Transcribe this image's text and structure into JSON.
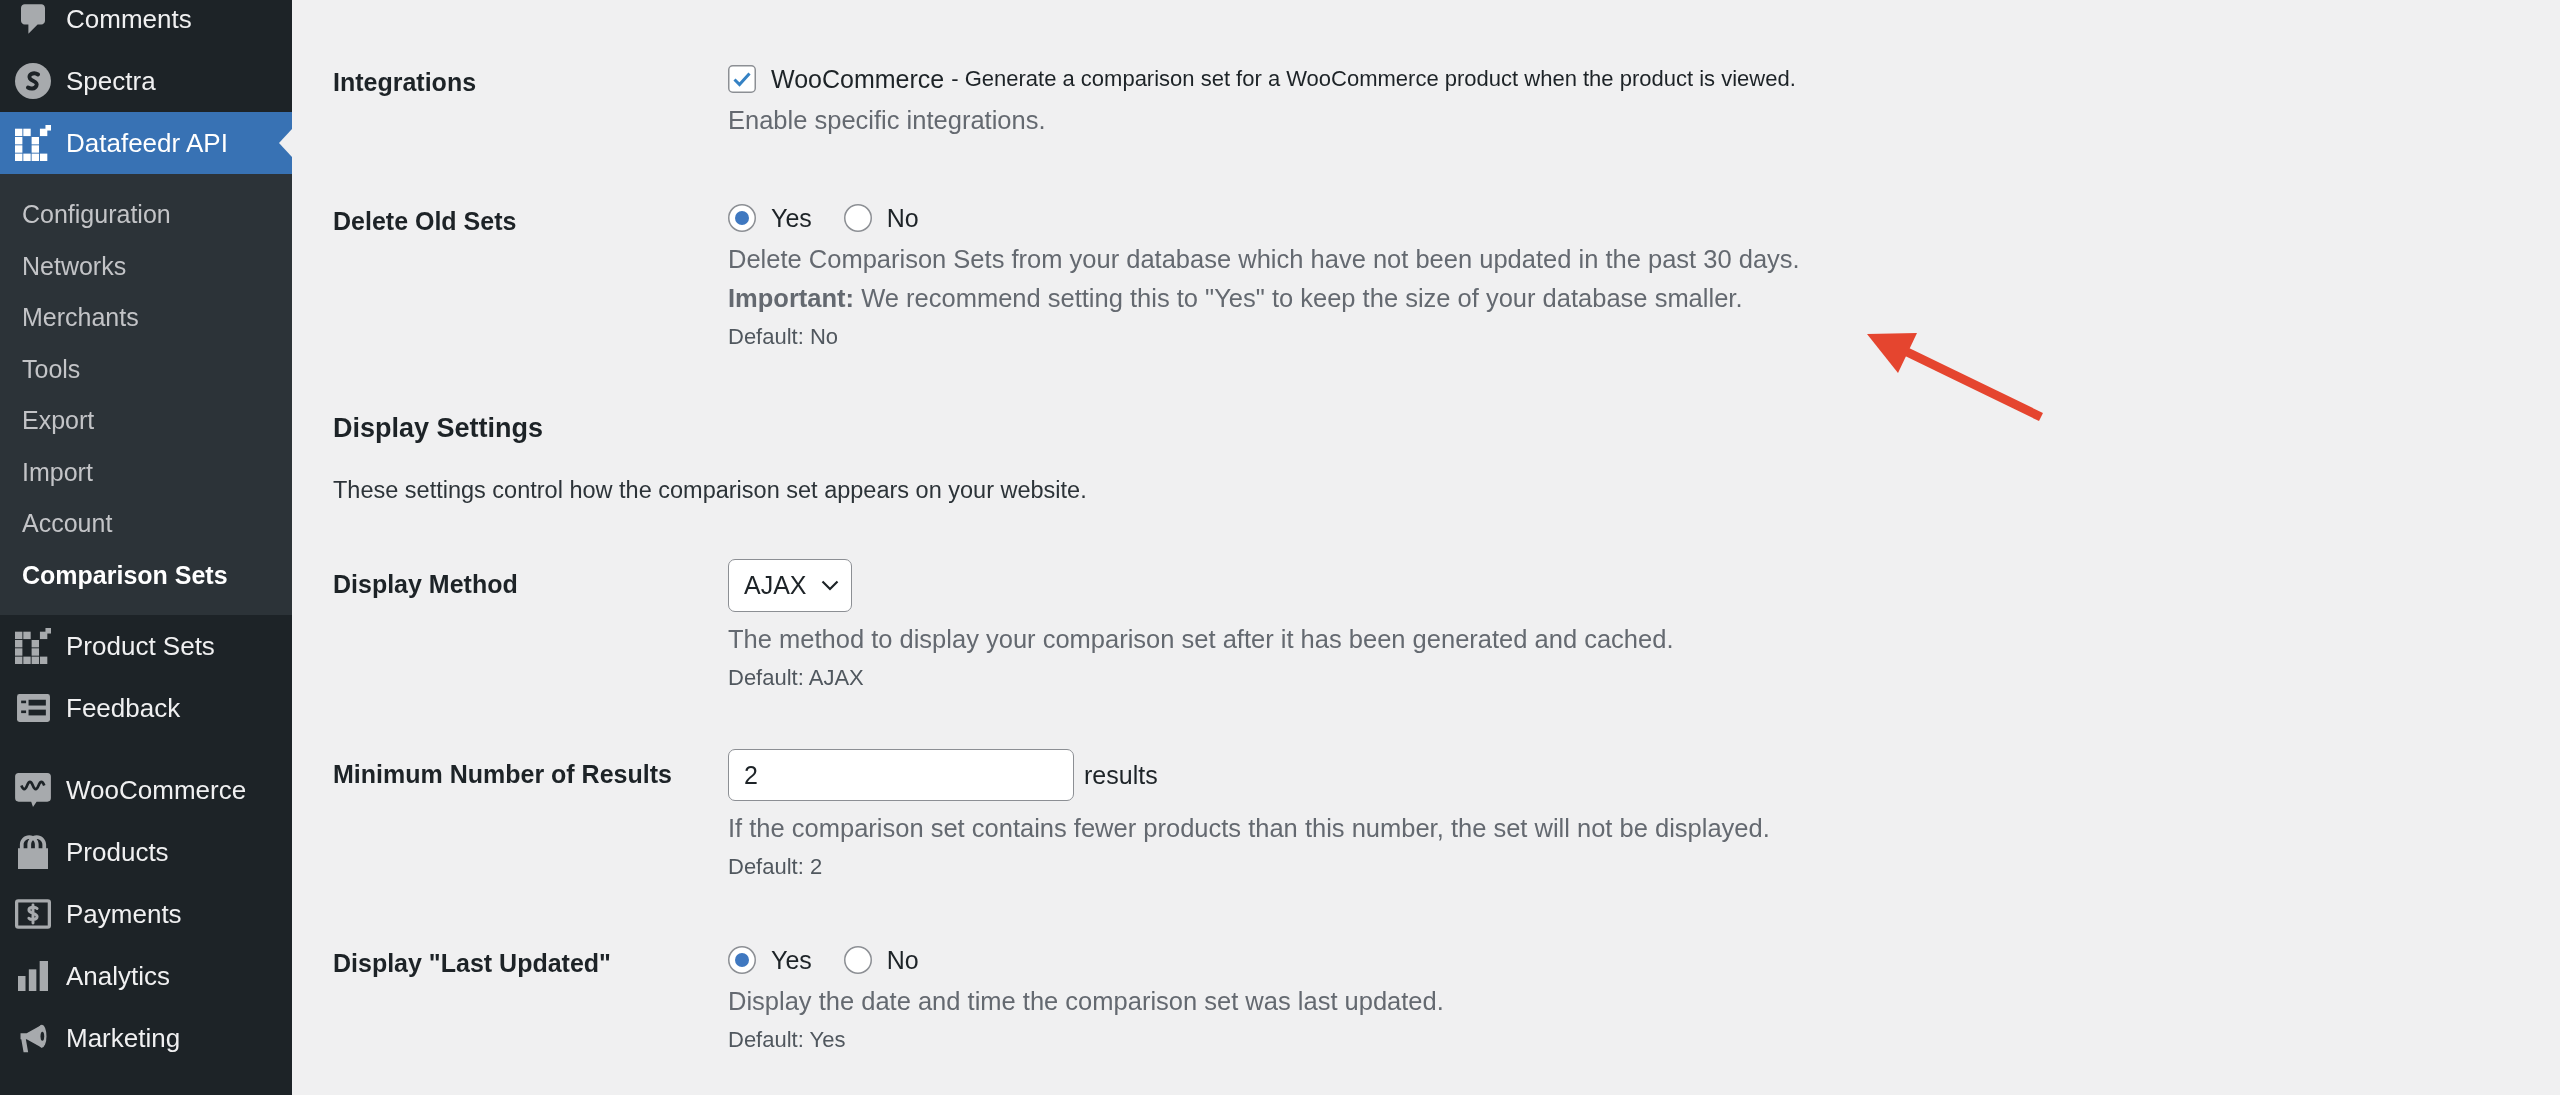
{
  "sidebar": {
    "groups": [
      {
        "items": [
          {
            "label": "Comments",
            "selected": false
          },
          {
            "label": "Spectra",
            "selected": false
          },
          {
            "label": "Datafeedr API",
            "selected": true,
            "children": [
              {
                "label": "Configuration",
                "selected": false
              },
              {
                "label": "Networks",
                "selected": false
              },
              {
                "label": "Merchants",
                "selected": false
              },
              {
                "label": "Tools",
                "selected": false
              },
              {
                "label": "Export",
                "selected": false
              },
              {
                "label": "Import",
                "selected": false
              },
              {
                "label": "Account",
                "selected": false
              },
              {
                "label": "Comparison Sets",
                "selected": true
              }
            ]
          },
          {
            "label": "Product Sets",
            "selected": false
          },
          {
            "label": "Feedback",
            "selected": false
          }
        ]
      },
      {
        "items": [
          {
            "label": "WooCommerce",
            "selected": false
          },
          {
            "label": "Products",
            "selected": false
          },
          {
            "label": "Payments",
            "selected": false
          },
          {
            "label": "Analytics",
            "selected": false
          },
          {
            "label": "Marketing",
            "selected": false
          }
        ]
      }
    ]
  },
  "settings": {
    "sections": [
      {
        "rows": [
          {
            "label": "Integrations",
            "kind": "checkboxes",
            "options": [
              {
                "label": "WooCommerce",
                "note": "- Generate a comparison set for a WooCommerce product when the product is viewed.",
                "checked": true
              }
            ],
            "description": [
              "Enable specific integrations."
            ]
          },
          {
            "label": "Delete Old Sets",
            "kind": "radios",
            "options": [
              {
                "label": "Yes",
                "selected": true
              },
              {
                "label": "No",
                "selected": false
              }
            ],
            "description": [
              "Delete Comparison Sets from your database which have not been updated in the past 30 days.",
              "**Important:** We recommend setting this to \"Yes\" to keep the size of your database smaller."
            ],
            "default": "Default: No"
          }
        ]
      },
      {
        "heading": "Display Settings",
        "intro": "These settings control how the comparison set appears on your website.",
        "rows": [
          {
            "label": "Display Method",
            "kind": "select",
            "value": "AJAX",
            "description": [
              "The method to display your comparison set after it has been generated and cached."
            ],
            "default": "Default: AJAX"
          },
          {
            "label": "Minimum Number of Results",
            "kind": "number",
            "value": "2",
            "suffix": "results",
            "description": [
              "If the comparison set contains fewer products than this number, the set will not be displayed."
            ],
            "default": "Default: 2"
          },
          {
            "label": "Display \"Last Updated\"",
            "kind": "radios",
            "options": [
              {
                "label": "Yes",
                "selected": true
              },
              {
                "label": "No",
                "selected": false
              }
            ],
            "description": [
              "Display the date and time the comparison set was last updated."
            ],
            "default": "Default: Yes"
          }
        ]
      }
    ]
  },
  "annotations": [
    {
      "kind": "arrow"
    }
  ]
}
